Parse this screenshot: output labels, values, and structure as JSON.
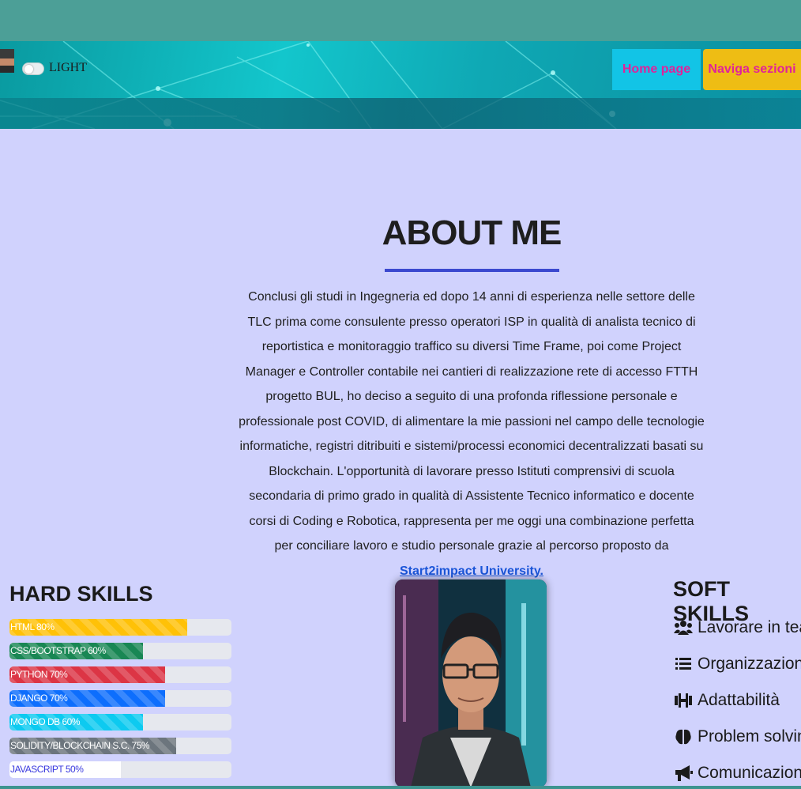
{
  "header": {
    "theme_toggle_label": "LIGHT",
    "nav": {
      "home": "Home page",
      "sections": "Naviga sezioni"
    }
  },
  "about": {
    "title": "ABOUT ME",
    "text": "Conclusi gli studi in Ingegneria ed dopo 14 anni di esperienza nelle settore delle TLC prima come consulente presso operatori ISP in qualità di analista tecnico di reportistica e monitoraggio traffico su diversi Time Frame, poi come Project Manager e Controller contabile nei cantieri di realizzazione rete di accesso FTTH progetto BUL, ho deciso a seguito di una profonda riflessione personale e professionale post COVID, di alimentare la mie passioni nel campo delle tecnologie informatiche, registri ditribuiti e sistemi/processi economici decentralizzati basati su Blockchain. L'opportunità di lavorare presso Istituti comprensivi di scuola secondaria di primo grado in qualità di Assistente Tecnico informatico e docente corsi di Coding e Robotica, rappresenta per me oggi una combinazione perfetta per conciliare lavoro e studio personale grazie al percorso proposto da",
    "link_text": "Start2impact University."
  },
  "hard_skills": {
    "title": "HARD SKILLS",
    "items": [
      {
        "label": "HTML 80%",
        "percent": 80,
        "color": "#ffc107",
        "text_color": "#ffffff"
      },
      {
        "label": "CSS/BOOTSTRAP 60%",
        "percent": 60,
        "color": "#198754",
        "text_color": "#ffffff"
      },
      {
        "label": "PYTHON 70%",
        "percent": 70,
        "color": "#dc3545",
        "text_color": "#ffffff"
      },
      {
        "label": "DJANGO 70%",
        "percent": 70,
        "color": "#0d6efd",
        "text_color": "#ffffff"
      },
      {
        "label": "MONGO DB 60%",
        "percent": 60,
        "color": "#0dcaf0",
        "text_color": "#ffffff"
      },
      {
        "label": "SOLIDITY/BLOCKCHAIN S.C. 75%",
        "percent": 75,
        "color": "#6c757d",
        "text_color": "#ffffff"
      },
      {
        "label": "JAVASCRIPT 50%",
        "percent": 50,
        "color": "#ffffff",
        "text_color": "#3a3adf"
      }
    ]
  },
  "soft_skills": {
    "title": "SOFT SKILLS",
    "items": [
      {
        "label": "Lavorare in team",
        "icon": "users-icon"
      },
      {
        "label": "Organizzazione",
        "icon": "list-icon"
      },
      {
        "label": "Adattabilità",
        "icon": "dumbbell-icon"
      },
      {
        "label": "Problem solving",
        "icon": "brain-icon"
      },
      {
        "label": "Comunicazione",
        "icon": "megaphone-icon"
      }
    ]
  }
}
